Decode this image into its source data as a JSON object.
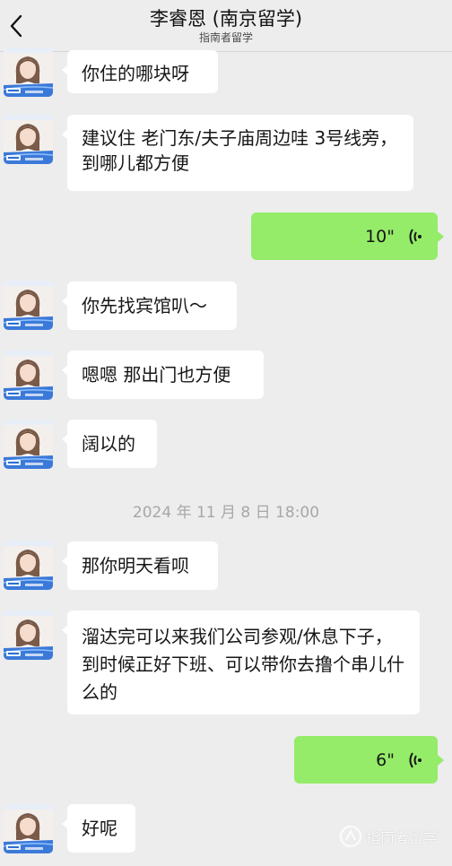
{
  "header": {
    "title": "李睿恩 (南京留学)",
    "subtitle": "指南者留学"
  },
  "contact": {
    "avatar_name": "李睿恩"
  },
  "messages": [
    {
      "dir": "in",
      "text": "你住的哪块呀"
    },
    {
      "dir": "in",
      "text": "建议住 老门东/夫子庙周边哇 3号线旁，到哪儿都方便"
    },
    {
      "dir": "out",
      "type": "voice",
      "duration": "10\""
    },
    {
      "dir": "in",
      "text": "你先找宾馆叭～"
    },
    {
      "dir": "in",
      "text": "嗯嗯 那出门也方便"
    },
    {
      "dir": "in",
      "text": "阔以的"
    },
    {
      "dir": "in",
      "text": "那你明天看呗"
    },
    {
      "dir": "in",
      "text": "溜达完可以来我们公司参观/休息下子，到时候正好下班、可以带你去撸个串儿什么的"
    },
    {
      "dir": "out",
      "type": "voice",
      "duration": "6\""
    },
    {
      "dir": "in",
      "text": "好呢"
    }
  ],
  "timestamp": "2024 年 11 月 8 日  18:00",
  "watermark": "指南者留学",
  "colors": {
    "background": "#ededed",
    "incoming_bubble": "#ffffff",
    "outgoing_bubble": "#95ec69",
    "avatar_accent": "#2b6fd6"
  },
  "icons": [
    "back-chevron-icon",
    "voice-wave-icon",
    "watermark-logo-icon"
  ]
}
